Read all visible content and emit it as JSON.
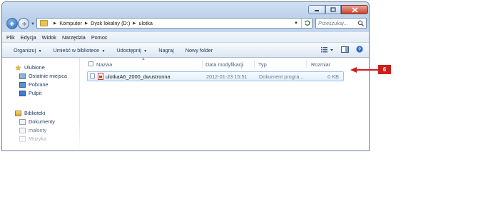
{
  "address_bar": {
    "crumbs": [
      "Komputer",
      "Dysk lokalny (D:)",
      "ulotka"
    ]
  },
  "search": {
    "placeholder": "Przeszukaj..."
  },
  "menu": {
    "items": [
      "Plik",
      "Edycja",
      "Widok",
      "Narzędzia",
      "Pomoc"
    ]
  },
  "toolbar": {
    "organize": "Organizuj",
    "library": "Umieść w bibliotece",
    "share": "Udostępnij",
    "burn": "Nagraj",
    "new_folder": "Nowy folder"
  },
  "nav_pane": {
    "favorites": {
      "label": "Ulubione",
      "items": [
        "Ostatnie miejsca",
        "Pobrane",
        "Pulpit"
      ]
    },
    "libraries": {
      "label": "Biblioteki",
      "items": [
        "Dokumenty",
        "makiety",
        "Muzyka"
      ]
    }
  },
  "columns": [
    "Nazwa",
    "Data modyfikacji",
    "Typ",
    "Rozmiar"
  ],
  "files": [
    {
      "name": "ulotkaA6_2000_dwustronna",
      "modified": "2012-01-23 15:51",
      "type": "Dokument progra...",
      "size": "0 KB"
    }
  ],
  "callout": {
    "number": "6",
    "color": "#cc1f1a"
  },
  "colors": {
    "titlebar": "#c5d8ee",
    "selection": "#e2f0fd",
    "text": "#1e3a5f"
  }
}
